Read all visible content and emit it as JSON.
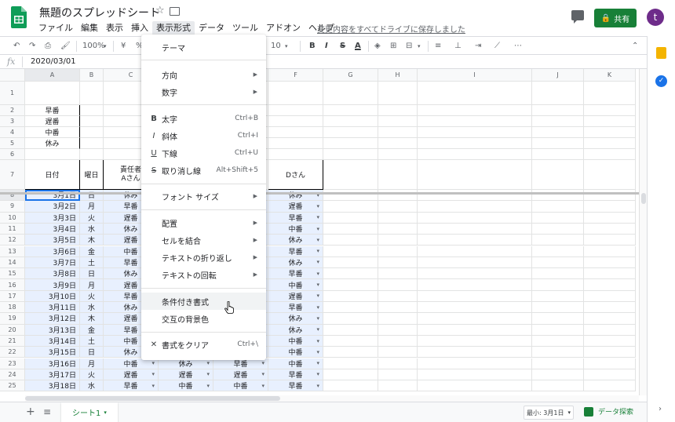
{
  "app": {
    "doc_title": "無題のスプレッドシート",
    "saved_text": "変更内容をすべてドライブに保存しました",
    "share_label": "共有",
    "avatar_initial": "t",
    "menus": [
      "ファイル",
      "編集",
      "表示",
      "挿入",
      "表示形式",
      "データ",
      "ツール",
      "アドオン",
      "ヘルプ"
    ],
    "active_menu": "表示形式"
  },
  "toolbar": {
    "zoom": "100%",
    "currency": "¥",
    "percent": "%",
    "font_size": "10",
    "bold": "B",
    "italic": "I",
    "strike": "S",
    "text_color": "A"
  },
  "formula_bar": {
    "fx_label": "fx",
    "value": "2020/03/01"
  },
  "columns": [
    "A",
    "B",
    "C",
    "D",
    "E",
    "F",
    "G",
    "H",
    "I",
    "J",
    "K"
  ],
  "rows": [
    "1",
    "2",
    "3",
    "4",
    "5",
    "6",
    "7",
    "8",
    "9",
    "10",
    "11",
    "12",
    "13",
    "14",
    "15",
    "16",
    "17",
    "18",
    "19",
    "20",
    "21",
    "22",
    "23",
    "24",
    "25"
  ],
  "legend": [
    "早番",
    "遅番",
    "中番",
    "休み"
  ],
  "table_header": {
    "date": "日付",
    "weekday": "曜日",
    "c_header_line1": "責任者",
    "c_header_line2": "Aさん",
    "f_header": "Dさん"
  },
  "data_rows": [
    {
      "date": "3月1日",
      "wd": "日",
      "c": "休み",
      "d": "",
      "e": "",
      "f": "休み"
    },
    {
      "date": "3月2日",
      "wd": "月",
      "c": "早番",
      "d": "",
      "e": "",
      "f": "遅番"
    },
    {
      "date": "3月3日",
      "wd": "火",
      "c": "遅番",
      "d": "",
      "e": "",
      "f": "早番"
    },
    {
      "date": "3月4日",
      "wd": "水",
      "c": "休み",
      "d": "",
      "e": "",
      "f": "中番"
    },
    {
      "date": "3月5日",
      "wd": "木",
      "c": "遅番",
      "d": "",
      "e": "",
      "f": "休み"
    },
    {
      "date": "3月6日",
      "wd": "金",
      "c": "中番",
      "d": "",
      "e": "",
      "f": "早番"
    },
    {
      "date": "3月7日",
      "wd": "土",
      "c": "早番",
      "d": "",
      "e": "",
      "f": "休み"
    },
    {
      "date": "3月8日",
      "wd": "日",
      "c": "休み",
      "d": "",
      "e": "",
      "f": "早番"
    },
    {
      "date": "3月9日",
      "wd": "月",
      "c": "遅番",
      "d": "",
      "e": "",
      "f": "中番"
    },
    {
      "date": "3月10日",
      "wd": "火",
      "c": "早番",
      "d": "",
      "e": "",
      "f": "遅番"
    },
    {
      "date": "3月11日",
      "wd": "水",
      "c": "休み",
      "d": "",
      "e": "",
      "f": "早番"
    },
    {
      "date": "3月12日",
      "wd": "木",
      "c": "遅番",
      "d": "",
      "e": "",
      "f": "休み"
    },
    {
      "date": "3月13日",
      "wd": "金",
      "c": "早番",
      "d": "",
      "e": "",
      "f": "休み"
    },
    {
      "date": "3月14日",
      "wd": "土",
      "c": "中番",
      "d": "",
      "e": "",
      "f": "中番"
    },
    {
      "date": "3月15日",
      "wd": "日",
      "c": "休み",
      "d": "",
      "e": "",
      "f": "中番"
    },
    {
      "date": "3月16日",
      "wd": "月",
      "c": "中番",
      "d": "休み",
      "e": "早番",
      "f": "中番"
    },
    {
      "date": "3月17日",
      "wd": "火",
      "c": "遅番",
      "d": "遅番",
      "e": "遅番",
      "f": "早番"
    },
    {
      "date": "3月18日",
      "wd": "水",
      "c": "早番",
      "d": "中番",
      "e": "中番",
      "f": "早番"
    }
  ],
  "format_menu": {
    "items": [
      {
        "label": "テーマ"
      },
      {
        "label": "方向",
        "submenu": true
      },
      {
        "label": "数字",
        "submenu": true
      },
      {
        "label": "太字",
        "icon": "B",
        "shortcut": "Ctrl+B"
      },
      {
        "label": "斜体",
        "icon": "I",
        "shortcut": "Ctrl+I"
      },
      {
        "label": "下線",
        "icon": "U",
        "shortcut": "Ctrl+U"
      },
      {
        "label": "取り消し線",
        "icon": "S",
        "shortcut": "Alt+Shift+5"
      },
      {
        "label": "フォント サイズ",
        "submenu": true
      },
      {
        "label": "配置",
        "submenu": true
      },
      {
        "label": "セルを結合",
        "submenu": true
      },
      {
        "label": "テキストの折り返し",
        "submenu": true
      },
      {
        "label": "テキストの回転",
        "submenu": true
      },
      {
        "label": "条件付き書式",
        "hover": true
      },
      {
        "label": "交互の背景色"
      },
      {
        "label": "書式をクリア",
        "icon": "✕",
        "shortcut": "Ctrl+\\"
      }
    ]
  },
  "bottom_bar": {
    "add_sheet": "+",
    "sheet_list": "≡",
    "sheet_name": "シート1",
    "min_label": "最小: 3月1日",
    "explore_label": "データ探索"
  },
  "colors": {
    "brand_green": "#188038",
    "accent_blue": "#1a73e8",
    "selection": "#e8f0fe"
  }
}
